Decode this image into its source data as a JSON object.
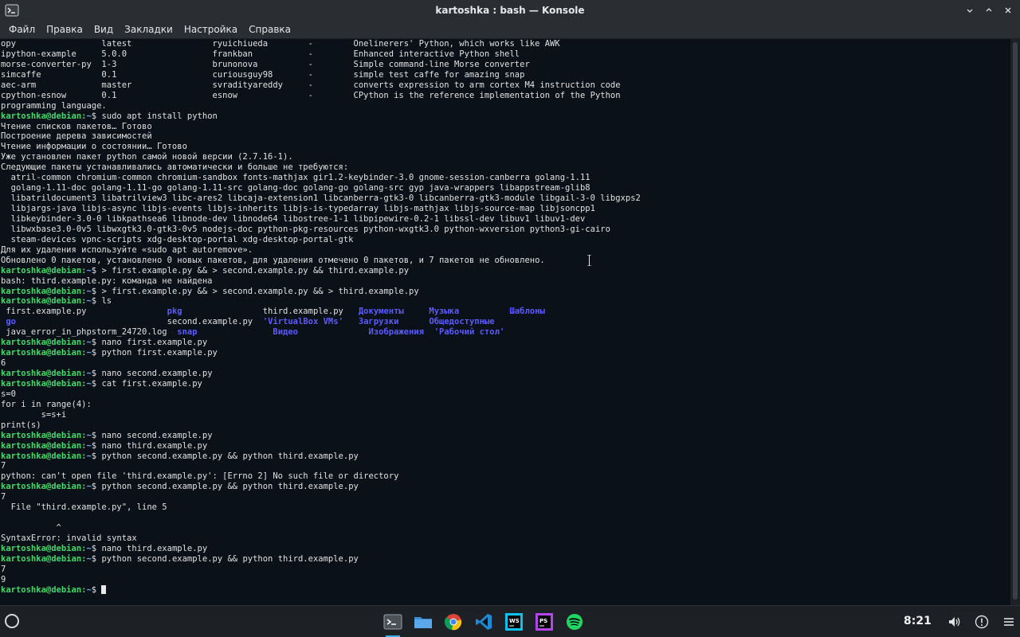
{
  "window": {
    "title": "kartoshka : bash — Konsole"
  },
  "menu": [
    {
      "id": "file",
      "label": "Файл"
    },
    {
      "id": "edit",
      "label": "Правка"
    },
    {
      "id": "view",
      "label": "Вид"
    },
    {
      "id": "bookmarks",
      "label": "Закладки"
    },
    {
      "id": "settings",
      "label": "Настройка"
    },
    {
      "id": "help",
      "label": "Справка"
    }
  ],
  "prompt": {
    "user": "kartoshka@debian",
    "path": "~",
    "symbol": "$"
  },
  "terminal_lines": [
    {
      "text": "opy                 latest                ryuichiueda        -        Onelinerers' Python, which works like AWK"
    },
    {
      "text": "ipython-example     5.0.0                 frankban           -        Enhanced interactive Python shell"
    },
    {
      "text": "morse-converter-py  1-3                   brunonova          -        Simple command-line Morse converter"
    },
    {
      "text": "simcaffe            0.1                   curiousguy98       -        simple test caffe for amazing snap"
    },
    {
      "text": "aec-arm             master                svradityareddy     -        converts expression to arm cortex M4 instruction code"
    },
    {
      "text": "cpython-esnow       0.1                   esnow              -        CPython is the reference implementation of the Python"
    },
    {
      "text": "programming language."
    },
    {
      "prompt": true,
      "text": "sudo apt install python"
    },
    {
      "text": "Чтение списков пакетов… Готово"
    },
    {
      "text": "Построение дерева зависимостей"
    },
    {
      "text": "Чтение информации о состоянии… Готово"
    },
    {
      "text": "Уже установлен пакет python самой новой версии (2.7.16-1)."
    },
    {
      "text": "Следующие пакеты устанавливались автоматически и больше не требуются:"
    },
    {
      "text": "  atril-common chromium-common chromium-sandbox fonts-mathjax gir1.2-keybinder-3.0 gnome-session-canberra golang-1.11"
    },
    {
      "text": "  golang-1.11-doc golang-1.11-go golang-1.11-src golang-doc golang-go golang-src gyp java-wrappers libappstream-glib8"
    },
    {
      "text": "  libatrildocument3 libatrilview3 libc-ares2 libcaja-extension1 libcanberra-gtk3-0 libcanberra-gtk3-module libgail-3-0 libgxps2"
    },
    {
      "text": "  libjargs-java libjs-async libjs-events libjs-inherits libjs-is-typedarray libjs-mathjax libjs-source-map libjsoncpp1"
    },
    {
      "text": "  libkeybinder-3.0-0 libkpathsea6 libnode-dev libnode64 libostree-1-1 libpipewire-0.2-1 libssl-dev libuv1 libuv1-dev"
    },
    {
      "text": "  libwxbase3.0-0v5 libwxgtk3.0-gtk3-0v5 nodejs-doc python-pkg-resources python-wxgtk3.0 python-wxversion python3-gi-cairo"
    },
    {
      "text": "  steam-devices vpnc-scripts xdg-desktop-portal xdg-desktop-portal-gtk"
    },
    {
      "text": "Для их удаления используйте «sudo apt autoremove»."
    },
    {
      "text": "Обновлено 0 пакетов, установлено 0 новых пакетов, для удаления отмечено 0 пакетов, и 7 пакетов не обновлено."
    },
    {
      "prompt": true,
      "text": "> first.example.py && > second.example.py && third.example.py"
    },
    {
      "text": "bash: third.example.py: команда не найдена"
    },
    {
      "prompt": true,
      "text": "> first.example.py && > second.example.py && > third.example.py"
    },
    {
      "prompt": true,
      "text": "ls"
    },
    {
      "segments": [
        {
          "t": " first.example.py                "
        },
        {
          "t": "pkg",
          "c": "d"
        },
        {
          "t": "                third.example.py   "
        },
        {
          "t": "Документы",
          "c": "d"
        },
        {
          "t": "     "
        },
        {
          "t": "Музыка",
          "c": "d"
        },
        {
          "t": "          "
        },
        {
          "t": "Шаблоны",
          "c": "d"
        }
      ]
    },
    {
      "segments": [
        {
          "t": " "
        },
        {
          "t": "go",
          "c": "d"
        },
        {
          "t": "                              second.example.py  "
        },
        {
          "t": "'VirtualBox VMs'",
          "c": "d"
        },
        {
          "t": "   "
        },
        {
          "t": "Загрузки",
          "c": "d"
        },
        {
          "t": "      "
        },
        {
          "t": "Общедоступные",
          "c": "d"
        }
      ]
    },
    {
      "segments": [
        {
          "t": " java_error_in_phpstorm_24720.log  "
        },
        {
          "t": "snap",
          "c": "d"
        },
        {
          "t": "               "
        },
        {
          "t": "Видео",
          "c": "d"
        },
        {
          "t": "              "
        },
        {
          "t": "Изображения",
          "c": "d"
        },
        {
          "t": "  "
        },
        {
          "t": "'Рабочий стол'",
          "c": "d"
        }
      ]
    },
    {
      "prompt": true,
      "text": "nano first.example.py"
    },
    {
      "prompt": true,
      "text": "python first.example.py"
    },
    {
      "text": "6"
    },
    {
      "prompt": true,
      "text": "nano second.example.py"
    },
    {
      "prompt": true,
      "text": "cat first.example.py"
    },
    {
      "text": "s=0"
    },
    {
      "text": "for i in range(4):"
    },
    {
      "text": "        s=s+i"
    },
    {
      "text": "print(s)"
    },
    {
      "prompt": true,
      "text": "nano second.example.py"
    },
    {
      "prompt": true,
      "text": "nano third.example.py"
    },
    {
      "prompt": true,
      "text": "python second.example.py && python third.example.py"
    },
    {
      "text": "7"
    },
    {
      "text": "python: can't open file 'third.example.py': [Errno 2] No such file or directory"
    },
    {
      "prompt": true,
      "text": "python second.example.py && python third.example.py"
    },
    {
      "text": "7"
    },
    {
      "text": "  File \"third.example.py\", line 5"
    },
    {
      "text": ""
    },
    {
      "text": "           ^"
    },
    {
      "text": "SyntaxError: invalid syntax"
    },
    {
      "prompt": true,
      "text": "nano third.example.py"
    },
    {
      "prompt": true,
      "text": "python second.example.py && python third.example.py"
    },
    {
      "text": "7"
    },
    {
      "text": "9"
    },
    {
      "prompt": true,
      "text": "",
      "cursor": true
    }
  ],
  "taskbar": {
    "clock": "8:21",
    "apps": [
      {
        "name": "konsole",
        "icon": "terminal-icon",
        "active": true
      },
      {
        "name": "files",
        "icon": "folder-icon"
      },
      {
        "name": "chrome",
        "icon": "chrome-icon"
      },
      {
        "name": "vscode",
        "icon": "vscode-icon"
      },
      {
        "name": "webstorm",
        "icon": "webstorm-icon",
        "label": "WS"
      },
      {
        "name": "phpstorm",
        "icon": "phpstorm-icon",
        "label": "PS"
      },
      {
        "name": "spotify",
        "icon": "spotify-icon"
      }
    ],
    "tray": [
      {
        "icon": "volume-icon"
      },
      {
        "icon": "notifications-icon"
      },
      {
        "icon": "menu-icon"
      }
    ]
  },
  "colors": {
    "prompt_user": "#3fd86a",
    "prompt_path": "#5ab0ff",
    "directory": "#5a5aff",
    "terminal_bg": "#0b1118",
    "accent": "#3daee9"
  }
}
